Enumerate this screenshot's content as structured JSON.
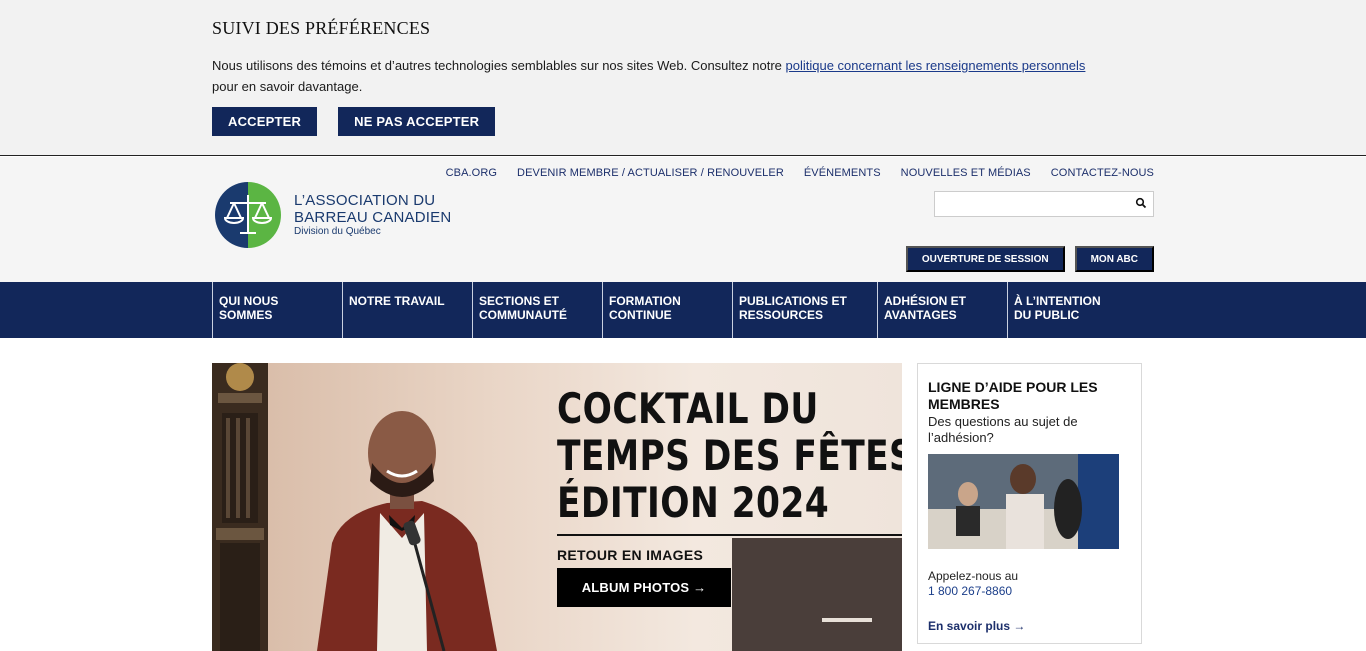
{
  "cookie": {
    "title": "SUIVI DES PRÉFÉRENCES",
    "text_before": "Nous utilisons des témoins et d’autres technologies semblables sur nos sites Web. Consultez notre ",
    "link": "politique concernant les renseignements personnels",
    "text_after": " pour en savoir davantage.",
    "accept_label": "ACCEPTER",
    "decline_label": "NE PAS ACCEPTER"
  },
  "utility_nav": {
    "items": [
      "CBA.ORG",
      "DEVENIR MEMBRE / ACTUALISER / RENOUVELER",
      "ÉVÉNEMENTS",
      "NOUVELLES ET MÉDIAS",
      "CONTACTEZ-NOUS"
    ]
  },
  "logo": {
    "line1": "L’ASSOCIATION DU",
    "line2": "BARREAU CANADIEN",
    "line3": "Division du Québec"
  },
  "search": {
    "placeholder": ""
  },
  "account": {
    "login_label": "OUVERTURE DE SESSION",
    "myabc_label": "MON ABC"
  },
  "main_nav": {
    "items": [
      {
        "line1": "QUI NOUS",
        "line2": "SOMMES"
      },
      {
        "line1": "NOTRE TRAVAIL",
        "line2": ""
      },
      {
        "line1": "SECTIONS ET",
        "line2": "COMMUNAUTÉ"
      },
      {
        "line1": "FORMATION",
        "line2": "CONTINUE"
      },
      {
        "line1": "PUBLICATIONS ET",
        "line2": "RESSOURCES"
      },
      {
        "line1": "ADHÉSION ET",
        "line2": "AVANTAGES"
      },
      {
        "line1": "À L’INTENTION",
        "line2": "DU PUBLIC"
      }
    ]
  },
  "hero": {
    "title_line1": "COCKTAIL DU",
    "title_line2": "TEMPS DES FÊTES",
    "title_line3": "ÉDITION 2024",
    "subtitle": "RETOUR EN IMAGES",
    "button_label": "ALBUM PHOTOS →"
  },
  "helpline": {
    "title": "LIGNE D’AIDE POUR LES MEMBRES",
    "subtitle": "Des questions au sujet de l’adhésion?",
    "call_label": "Appelez-nous au",
    "phone": "1 800 267-8860",
    "more_label": "En savoir plus →"
  },
  "colors": {
    "navy": "#12275a",
    "brand_blue": "#1a3a6e",
    "brand_green": "#5bb543",
    "link_blue": "#1b3a8a"
  }
}
